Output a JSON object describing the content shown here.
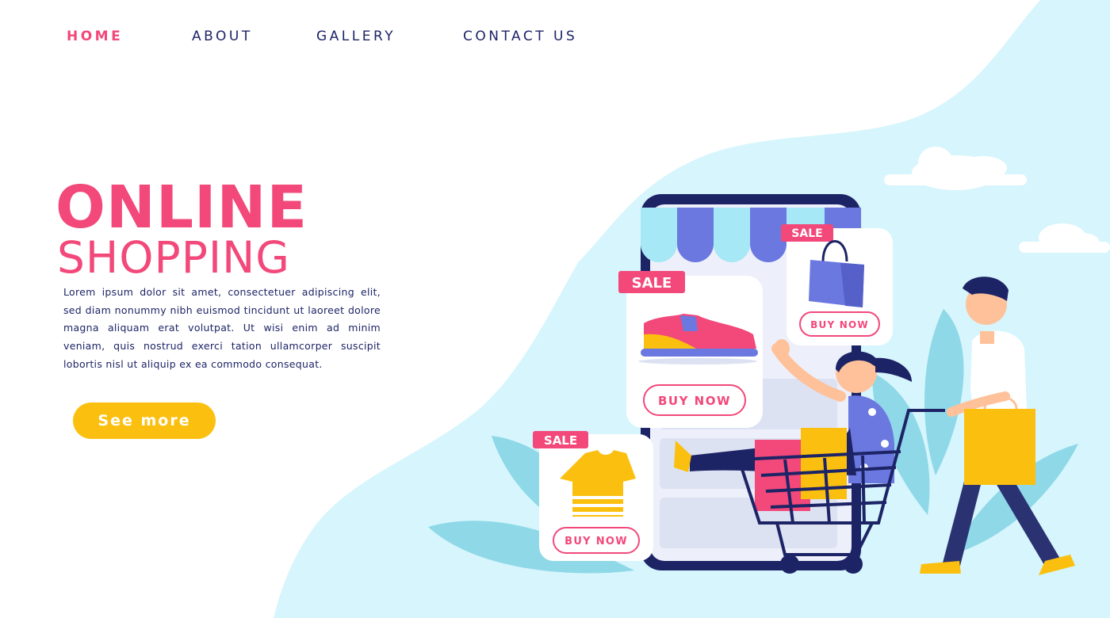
{
  "nav": {
    "items": [
      {
        "label": "HOME",
        "active": true
      },
      {
        "label": "ABOUT",
        "active": false
      },
      {
        "label": "GALLERY",
        "active": false
      },
      {
        "label": "CONTACT US",
        "active": false
      }
    ]
  },
  "hero": {
    "title_line1": "ONLINE",
    "title_line2": "SHOPPING",
    "body": "Lorem ipsum dolor sit amet, consectetuer adipiscing elit, sed diam nonummy nibh euismod tincidunt ut laoreet dolore magna aliquam erat volutpat. Ut wisi enim ad minim veniam, quis nostrud exerci tation ullamcorper suscipit lobortis nisl ut aliquip ex ea commodo consequat.",
    "cta_label": "See more"
  },
  "products": {
    "sneaker": {
      "badge": "SALE",
      "button": "BUY NOW"
    },
    "bag": {
      "badge": "SALE",
      "button": "BUY NOW"
    },
    "tshirt": {
      "badge": "SALE",
      "button": "BUY NOW"
    }
  },
  "colors": {
    "brand_pink": "#f2487a",
    "navy": "#1d2466",
    "cta_yellow": "#fbc00f",
    "sky_blob": "#d6f5fc",
    "leaf": "#8ed8e8",
    "awning_blue": "#6b78e0"
  },
  "icons": [
    "sneaker-icon",
    "shopping-bag-icon",
    "tshirt-icon",
    "cloud-icon",
    "shopping-cart-icon"
  ]
}
